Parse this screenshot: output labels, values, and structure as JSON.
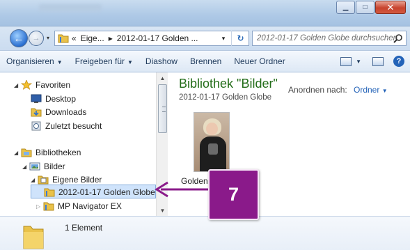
{
  "window": {
    "minimize_glyph": "▁",
    "maximize_glyph": "□",
    "close_glyph": "✕"
  },
  "address": {
    "breadcrumbs": [
      "«",
      "Eige...",
      "▸",
      "2012-01-17 Golden ..."
    ],
    "dropdown_glyph": "▾",
    "refresh_glyph": "↻",
    "search_placeholder": "2012-01-17 Golden Globe durchsuchen"
  },
  "commandbar": {
    "organize": "Organisieren",
    "share": "Freigeben für",
    "slideshow": "Diashow",
    "burn": "Brennen",
    "new_folder": "Neuer Ordner",
    "dropdown_glyph": "▼",
    "help_glyph": "?"
  },
  "navpane": {
    "favorites": "Favoriten",
    "desktop": "Desktop",
    "downloads": "Downloads",
    "recent": "Zuletzt besucht",
    "libraries": "Bibliotheken",
    "pictures": "Bilder",
    "my_pictures": "Eigene Bilder",
    "selected_folder": "2012-01-17 Golden Globe",
    "mp_navigator": "MP Navigator EX",
    "open_glyph": "◢",
    "closed_glyph": "▷"
  },
  "content": {
    "library_title": "Bibliothek \"Bilder\"",
    "library_subtitle": "2012-01-17 Golden Globe",
    "arrange_label": "Anordnen nach:",
    "arrange_value": "Ordner",
    "arrange_dropdown_glyph": "▼",
    "item_label": "Golden"
  },
  "details": {
    "item_count": "1 Element"
  },
  "callout": {
    "step_number": "7",
    "color": "#8a1a8a"
  }
}
